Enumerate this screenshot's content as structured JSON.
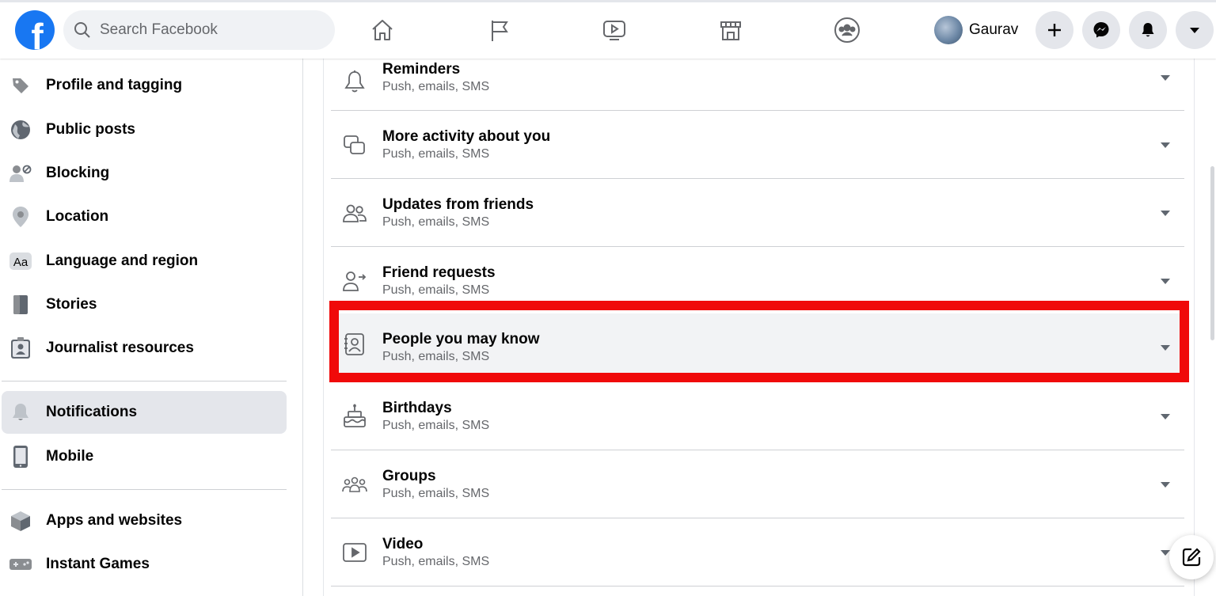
{
  "topbar": {
    "logo": "f",
    "search_placeholder": "Search Facebook",
    "nav_icons": [
      "home-icon",
      "pages-flag-icon",
      "watch-video-icon",
      "marketplace-icon",
      "groups-icon"
    ],
    "profile_name": "Gaurav",
    "action_icons": [
      "create-plus-icon",
      "messenger-icon",
      "notifications-bell-icon",
      "account-menu-icon"
    ]
  },
  "sidebar": {
    "items": [
      {
        "label": "Profile and tagging",
        "icon": "tag-icon"
      },
      {
        "label": "Public posts",
        "icon": "globe-icon"
      },
      {
        "label": "Blocking",
        "icon": "block-user-icon"
      },
      {
        "label": "Location",
        "icon": "location-pin-icon"
      },
      {
        "label": "Language and region",
        "icon": "language-icon"
      },
      {
        "label": "Stories",
        "icon": "stories-book-icon"
      },
      {
        "label": "Journalist resources",
        "icon": "journalist-badge-icon"
      },
      {
        "label": "Notifications",
        "icon": "bell-icon",
        "active": true
      },
      {
        "label": "Mobile",
        "icon": "mobile-phone-icon"
      },
      {
        "label": "Apps and websites",
        "icon": "cube-icon"
      },
      {
        "label": "Instant Games",
        "icon": "gamepad-icon"
      }
    ]
  },
  "notifications": {
    "rows": [
      {
        "title": "Reminders",
        "subtitle": "Push, emails, SMS",
        "icon": "bell-outline-icon"
      },
      {
        "title": "More activity about you",
        "subtitle": "Push, emails, SMS",
        "icon": "activity-squares-icon"
      },
      {
        "title": "Updates from friends",
        "subtitle": "Push, emails, SMS",
        "icon": "friends-icon"
      },
      {
        "title": "Friend requests",
        "subtitle": "Push, emails, SMS",
        "icon": "friend-request-icon"
      },
      {
        "title": "People you may know",
        "subtitle": "Push, emails, SMS",
        "icon": "contact-card-icon",
        "highlighted": true
      },
      {
        "title": "Birthdays",
        "subtitle": "Push, emails, SMS",
        "icon": "birthday-cake-icon"
      },
      {
        "title": "Groups",
        "subtitle": "Push, emails, SMS",
        "icon": "groups-outline-icon"
      },
      {
        "title": "Video",
        "subtitle": "Push, emails, SMS",
        "icon": "video-play-icon"
      }
    ]
  },
  "colors": {
    "brand": "#1877f2",
    "highlight_border": "#f00a0a",
    "active_bg": "#e4e6eb",
    "secondary_text": "#65676b"
  }
}
